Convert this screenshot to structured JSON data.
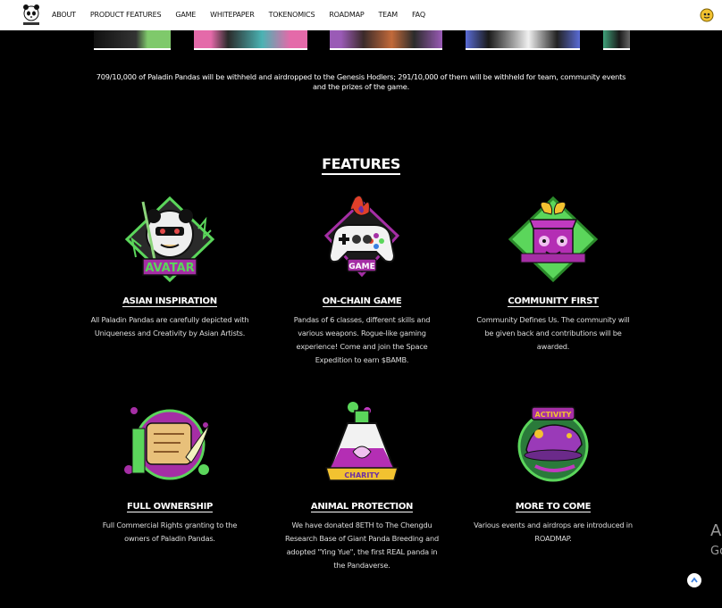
{
  "nav": {
    "items": [
      "ABOUT",
      "PRODUCT FEATURES",
      "GAME",
      "WHITEPAPER",
      "TOKENOMICS",
      "ROADMAP",
      "TEAM",
      "FAQ"
    ]
  },
  "intro": {
    "text_line1": "709/10,000 of Paladin Pandas will be withheld and airdropped to the Genesis Hodlers; 291/10,000 of them will be withheld for team, community events",
    "text_line2": "and the prizes of the game."
  },
  "features": {
    "title": "FEATURES",
    "items": [
      {
        "title": "ASIAN INSPIRATION",
        "desc": "All Paladin Pandas are carefully depicted with Uniqueness and Creativity by Asian Artists.",
        "badge_text": "AVATAR",
        "icon": "avatar-badge-icon"
      },
      {
        "title": "ON-CHAIN GAME",
        "desc": "Pandas of 6 classes, different skills and various weapons. Rogue-like gaming experience! Come and join the Space Expedition to earn $BAMB.",
        "badge_text": "GAME",
        "icon": "game-controller-icon"
      },
      {
        "title": "COMMUNITY FIRST",
        "desc": "Community Defines Us. The community will be given back and contributions will be awarded.",
        "badge_text": "",
        "icon": "gift-box-icon"
      },
      {
        "title": "FULL OWNERSHIP",
        "desc": "Full Commercial Rights granting to the owners of Paladin Pandas.",
        "badge_text": "",
        "icon": "scroll-quill-icon"
      },
      {
        "title": "ANIMAL PROTECTION",
        "desc": "We have donated 8ETH to The Chengdu Research Base of Giant Panda Breeding and adopted \"Ying Yue\", the first REAL panda in the Pandaverse.",
        "badge_text": "CHARITY",
        "icon": "potion-bottle-icon"
      },
      {
        "title": "MORE TO COME",
        "desc": "Various events and airdrops are introduced in ROADMAP.",
        "badge_text": "ACTIVITY",
        "icon": "activity-hat-icon"
      }
    ]
  },
  "edge": {
    "line1": "A",
    "line2": "Go"
  },
  "colors": {
    "accent_purple": "#a52ea5",
    "accent_green": "#5bd65b",
    "pink": "#e55aa8"
  }
}
